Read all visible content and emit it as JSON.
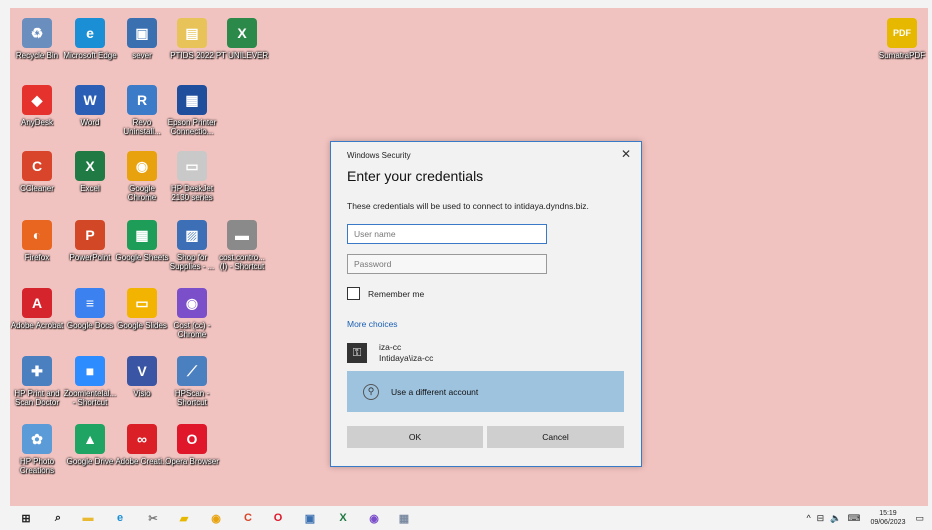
{
  "desktop": {
    "icons": [
      {
        "label": "Recycle Bin",
        "icon": "recycle-bin-icon",
        "glyph": "♻",
        "color": "#6a8fbf"
      },
      {
        "label": "Microsoft Edge",
        "icon": "edge-icon",
        "glyph": "e",
        "color": "#1b8fd6"
      },
      {
        "label": "sever",
        "icon": "network-drive-icon",
        "glyph": "▣",
        "color": "#3a6fb0"
      },
      {
        "label": "PTIDS 2022",
        "icon": "folder-icon",
        "glyph": "▤",
        "color": "#e7c35a"
      },
      {
        "label": "PT UNILEVER",
        "icon": "excel-file-icon",
        "glyph": "X",
        "color": "#2b8a4a"
      },
      {
        "label": "AnyDesk",
        "icon": "anydesk-icon",
        "glyph": "◆",
        "color": "#e5322d"
      },
      {
        "label": "Word",
        "icon": "word-icon",
        "glyph": "W",
        "color": "#2b5fb5"
      },
      {
        "label": "Revo Uninstall...",
        "icon": "revo-uninstaller-icon",
        "glyph": "R",
        "color": "#3b7bc8"
      },
      {
        "label": "Epson Printer Connectio...",
        "icon": "epson-printer-icon",
        "glyph": "▦",
        "color": "#1f4e9c"
      },
      {
        "label": "CCleaner",
        "icon": "ccleaner-icon",
        "glyph": "C",
        "color": "#d9452b"
      },
      {
        "label": "Excel",
        "icon": "excel-icon",
        "glyph": "X",
        "color": "#1f7a43"
      },
      {
        "label": "Google Chrome",
        "icon": "chrome-icon",
        "glyph": "◉",
        "color": "#e8a20e"
      },
      {
        "label": "HP DeskJet 2130 series",
        "icon": "printer-icon",
        "glyph": "▭",
        "color": "#c9c9c9"
      },
      {
        "label": "Firefox",
        "icon": "firefox-icon",
        "glyph": "◐",
        "color": "#e8661f"
      },
      {
        "label": "PowerPoint",
        "icon": "powerpoint-icon",
        "glyph": "P",
        "color": "#d24726"
      },
      {
        "label": "Google Sheets",
        "icon": "google-sheets-icon",
        "glyph": "▦",
        "color": "#1e9d58"
      },
      {
        "label": "Shop for Supplies - ...",
        "icon": "shop-supplies-icon",
        "glyph": "▨",
        "color": "#3c6fb5"
      },
      {
        "label": "cost.contro... (I) - Shortcut",
        "icon": "drive-shortcut-icon",
        "glyph": "▬",
        "color": "#8a8a8a"
      },
      {
        "label": "Adobe Acrobat",
        "icon": "acrobat-icon",
        "glyph": "A",
        "color": "#d5242b"
      },
      {
        "label": "Google Docs",
        "icon": "google-docs-icon",
        "glyph": "≡",
        "color": "#3b82f0"
      },
      {
        "label": "Google Slides",
        "icon": "google-slides-icon",
        "glyph": "▭",
        "color": "#f2b400"
      },
      {
        "label": "Cost (cc) - Chrome",
        "icon": "chrome-profile-icon",
        "glyph": "◉",
        "color": "#7b4fc9"
      },
      {
        "label": "HP Print and Scan Doctor",
        "icon": "hp-doctor-icon",
        "glyph": "✚",
        "color": "#4a7fc0"
      },
      {
        "label": "Zoomientelal... - Shortcut",
        "icon": "zoom-icon",
        "glyph": "■",
        "color": "#2d8cff"
      },
      {
        "label": "Visio",
        "icon": "visio-icon",
        "glyph": "V",
        "color": "#3955a3"
      },
      {
        "label": "HPScan - Shortcut",
        "icon": "hp-scan-icon",
        "glyph": "⟋",
        "color": "#4a7fc0"
      },
      {
        "label": "HP Photo Creations",
        "icon": "hp-photo-icon",
        "glyph": "✿",
        "color": "#5a9bd8"
      },
      {
        "label": "Google Drive",
        "icon": "google-drive-icon",
        "glyph": "▲",
        "color": "#1fa463"
      },
      {
        "label": "Adobe Creati...",
        "icon": "creative-cloud-icon",
        "glyph": "∞",
        "color": "#da1f26"
      },
      {
        "label": "Opera Browser",
        "icon": "opera-icon",
        "glyph": "O",
        "color": "#e0162b"
      },
      {
        "label": "SumatraPDF",
        "icon": "sumatra-pdf-icon",
        "glyph": "PDF",
        "color": "#e6b800"
      }
    ]
  },
  "dialog": {
    "window_title": "Windows Security",
    "close_glyph": "✕",
    "heading": "Enter your credentials",
    "description": "These credentials will be used to connect to intidaya.dyndns.biz.",
    "username_placeholder": "User name",
    "password_placeholder": "Password",
    "remember_label": "Remember me",
    "more_choices": "More choices",
    "saved_account": {
      "name": "iza-cc",
      "domain": "Intidaya\\iza-cc",
      "icon": "key-icon",
      "glyph": "⚿"
    },
    "different_account": {
      "label": "Use a different account",
      "icon": "person-icon",
      "glyph": "⚲"
    },
    "ok_label": "OK",
    "cancel_label": "Cancel"
  },
  "taskbar": {
    "items": [
      {
        "icon": "start-icon",
        "glyph": "⊞",
        "color": "#222"
      },
      {
        "icon": "search-icon",
        "glyph": "⌕",
        "color": "#222"
      },
      {
        "icon": "file-explorer-icon",
        "glyph": "▬",
        "color": "#e8b931"
      },
      {
        "icon": "edge-icon",
        "glyph": "e",
        "color": "#1b8fd6"
      },
      {
        "icon": "snipping-icon",
        "glyph": "✂",
        "color": "#7a7a7a"
      },
      {
        "icon": "foxit-icon",
        "glyph": "▰",
        "color": "#e6b800"
      },
      {
        "icon": "chrome-icon",
        "glyph": "◉",
        "color": "#e8a20e"
      },
      {
        "icon": "ccleaner-icon",
        "glyph": "C",
        "color": "#d9452b"
      },
      {
        "icon": "opera-icon",
        "glyph": "O",
        "color": "#e0162b"
      },
      {
        "icon": "remote-desktop-icon",
        "glyph": "▣",
        "color": "#3a6fb0"
      },
      {
        "icon": "excel-icon",
        "glyph": "X",
        "color": "#1f7a43"
      },
      {
        "icon": "chrome-profile-icon",
        "glyph": "◉",
        "color": "#7b4fc9"
      },
      {
        "icon": "calculator-icon",
        "glyph": "▦",
        "color": "#7a8aa0"
      }
    ],
    "tray": {
      "chevron": "^",
      "network_glyph": "⊟",
      "volume_glyph": "🔈",
      "keyboard_glyph": "⌨",
      "time": "15:19",
      "date": "09/06/2023",
      "notification_glyph": "▭"
    }
  }
}
